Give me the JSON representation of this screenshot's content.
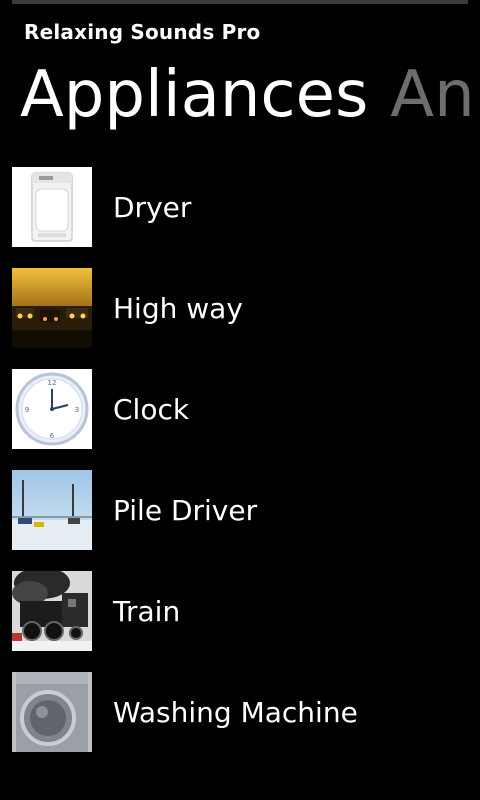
{
  "app": {
    "title": "Relaxing Sounds Pro"
  },
  "pivot": {
    "active": "Appliances",
    "next": "Ani"
  },
  "items": [
    {
      "label": "Dryer",
      "icon": "dryer-image"
    },
    {
      "label": "High way",
      "icon": "highway-image"
    },
    {
      "label": "Clock",
      "icon": "clock-image"
    },
    {
      "label": "Pile Driver",
      "icon": "pile-driver-image"
    },
    {
      "label": "Train",
      "icon": "train-image"
    },
    {
      "label": "Washing Machine",
      "icon": "washing-machine-image"
    }
  ],
  "colors": {
    "background": "#000000",
    "text": "#ffffff",
    "inactive_pivot": "#6d6d6d"
  }
}
